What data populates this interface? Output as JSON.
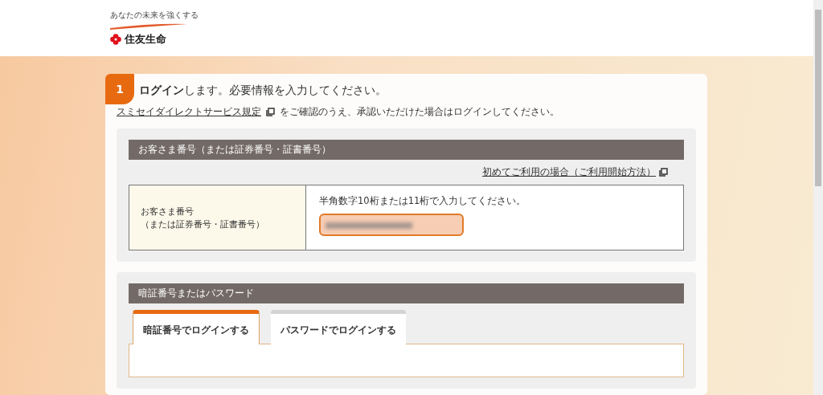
{
  "header": {
    "logo_tagline": "あなたの未来を強くする",
    "logo_name": "住友生命"
  },
  "step": {
    "number": "1",
    "title_bold": "ログイン",
    "title_rest": "します。必要情報を入力してください。"
  },
  "terms": {
    "link": "スミセイダイレクトサービス規定",
    "text": "をご確認のうえ、承認いただけた場合はログインしてください。"
  },
  "customer_section": {
    "heading": "お客さま番号（または証券番号・証書番号）",
    "help_link": "初めてご利用の場合（ご利用開始方法）",
    "label_line1": "お客さま番号",
    "label_line2": "（または証券番号・証書番号）",
    "hint": "半角数字10桁または11桁で入力してください。"
  },
  "password_section": {
    "heading": "暗証番号またはパスワード",
    "tabs": [
      {
        "label": "暗証番号でログインする",
        "selected": true
      },
      {
        "label": "パスワードでログインする",
        "selected": false
      }
    ]
  }
}
